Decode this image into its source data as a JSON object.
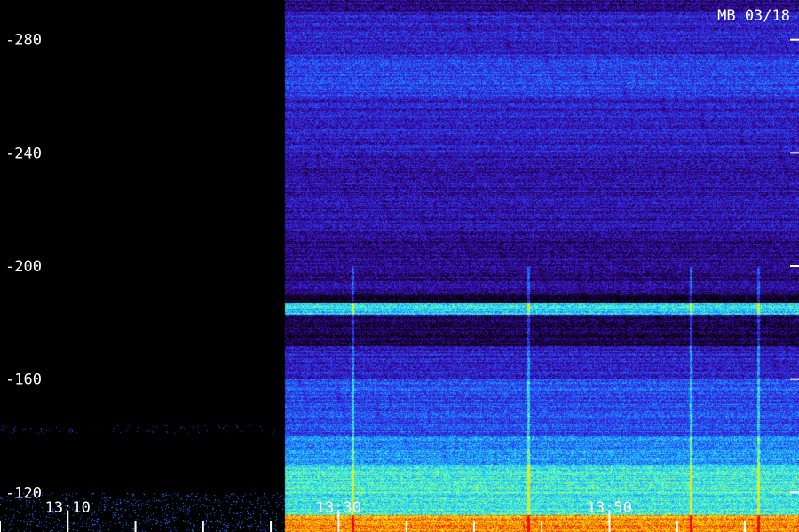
{
  "chart_data": {
    "type": "heatmap",
    "title": "MB 03/18",
    "xlabel": "",
    "ylabel": "",
    "y_ticks": [
      {
        "value": 280,
        "label": "-280"
      },
      {
        "value": 240,
        "label": "-240"
      },
      {
        "value": 200,
        "label": "-200"
      },
      {
        "value": 160,
        "label": "-160"
      },
      {
        "value": 120,
        "label": "-120"
      }
    ],
    "ylim": [
      106,
      294
    ],
    "x_major_ticks": [
      {
        "minutes": 10,
        "label": "13:10"
      },
      {
        "minutes": 30,
        "label": "13:30"
      },
      {
        "minutes": 50,
        "label": "13:50"
      }
    ],
    "xlim_minutes": [
      5,
      64
    ],
    "x_minor_step_minutes": 5,
    "no_data_until_minutes": 26,
    "colormap": [
      "#000000",
      "#2a006a",
      "#3a1ad0",
      "#1f5cff",
      "#1fb8ff",
      "#46ffd2",
      "#c8ff3a",
      "#ffe600",
      "#ff7a00",
      "#e80000"
    ],
    "intensity_bands": [
      {
        "y_from": 106,
        "y_to": 112,
        "level": 0.85
      },
      {
        "y_from": 112,
        "y_to": 130,
        "level": 0.52
      },
      {
        "y_from": 130,
        "y_to": 140,
        "level": 0.4
      },
      {
        "y_from": 140,
        "y_to": 160,
        "level": 0.3
      },
      {
        "y_from": 160,
        "y_to": 172,
        "level": 0.22
      },
      {
        "y_from": 172,
        "y_to": 178,
        "level": 0.08
      },
      {
        "y_from": 178,
        "y_to": 183,
        "level": 0.1
      },
      {
        "y_from": 183,
        "y_to": 187,
        "level": 0.48
      },
      {
        "y_from": 187,
        "y_to": 190,
        "level": 0.04
      },
      {
        "y_from": 190,
        "y_to": 210,
        "level": 0.14
      },
      {
        "y_from": 210,
        "y_to": 240,
        "level": 0.18
      },
      {
        "y_from": 240,
        "y_to": 260,
        "level": 0.22
      },
      {
        "y_from": 260,
        "y_to": 275,
        "level": 0.28
      },
      {
        "y_from": 275,
        "y_to": 290,
        "level": 0.22
      },
      {
        "y_from": 290,
        "y_to": 294,
        "level": 0.12
      }
    ],
    "vertical_streaks_minutes": [
      31,
      44,
      56,
      61
    ]
  }
}
